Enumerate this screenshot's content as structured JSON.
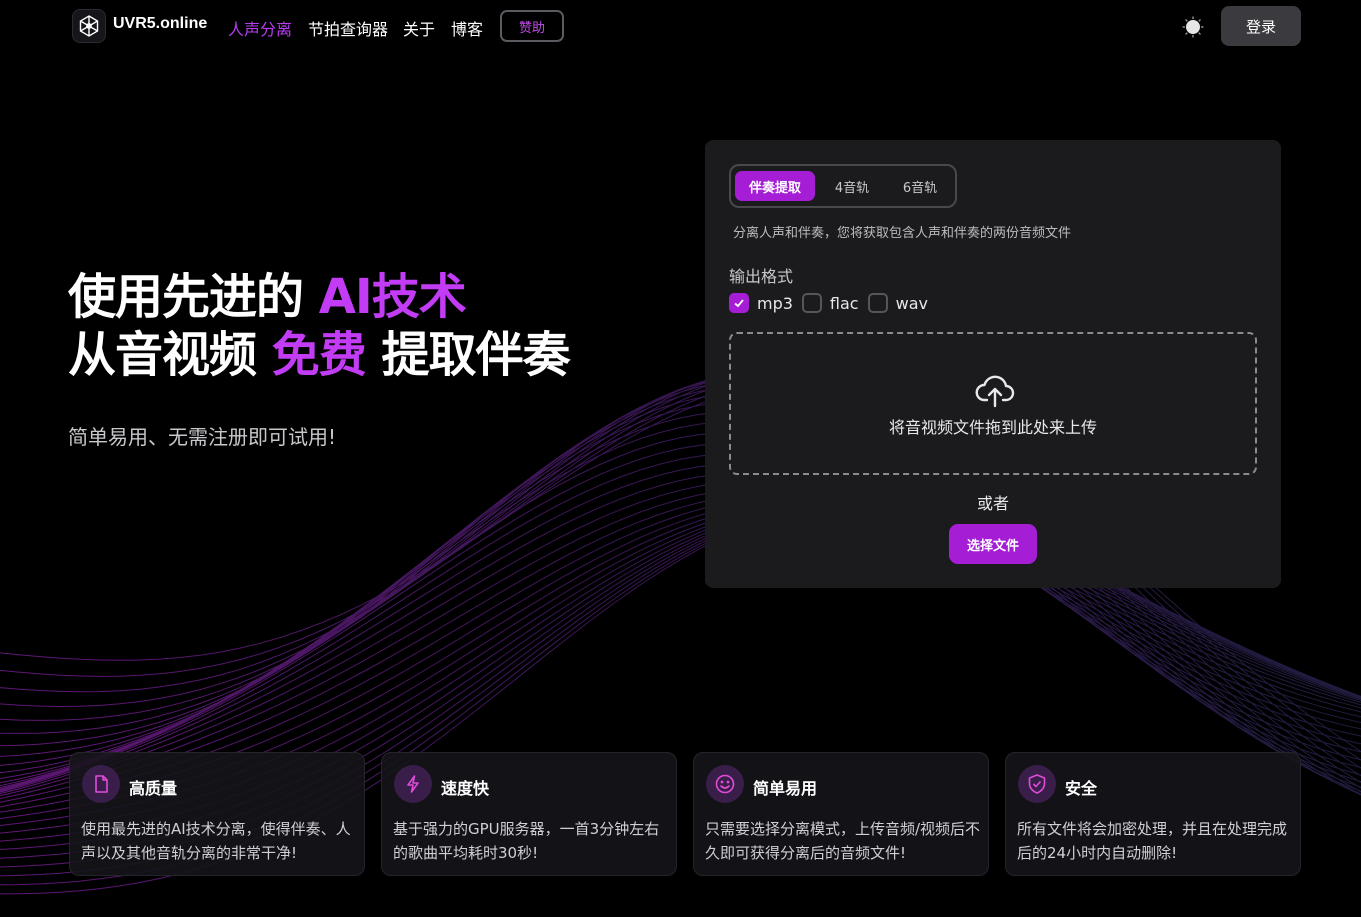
{
  "nav": {
    "brand": "UVR5.online",
    "links": [
      "人声分离",
      "节拍查询器",
      "关于",
      "博客"
    ],
    "active_link": "人声分离",
    "sponsor_label": "赞助",
    "login_label": "登录"
  },
  "hero": {
    "line1_pre": "使用先进的 ",
    "line1_hl": "AI技术",
    "line2_pre": "从音视频 ",
    "line2_hl": "免费",
    "line2_post": " 提取伴奏",
    "subtitle": "简单易用、无需注册即可试用!"
  },
  "panel": {
    "tabs": [
      "伴奏提取",
      "4音轨",
      "6音轨"
    ],
    "active_tab": "伴奏提取",
    "mode_description": "分离人声和伴奏，您将获取包含人声和伴奏的两份音频文件",
    "format_label": "输出格式",
    "formats": [
      {
        "label": "mp3",
        "checked": true
      },
      {
        "label": "flac",
        "checked": false
      },
      {
        "label": "wav",
        "checked": false
      }
    ],
    "dropzone_text": "将音视频文件拖到此处来上传",
    "or_text": "或者",
    "select_file_label": "选择文件"
  },
  "features": [
    {
      "icon": "file-icon",
      "title": "高质量",
      "desc": "使用最先进的AI技术分离，使得伴奏、人声以及其他音轨分离的非常干净!"
    },
    {
      "icon": "lightning-icon",
      "title": "速度快",
      "desc": "基于强力的GPU服务器，一首3分钟左右的歌曲平均耗时30秒!"
    },
    {
      "icon": "smile-icon",
      "title": "简单易用",
      "desc": "只需要选择分离模式，上传音频/视频后不久即可获得分离后的音频文件!"
    },
    {
      "icon": "shield-check-icon",
      "title": "安全",
      "desc": "所有文件将会加密处理，并且在处理完成后的24小时内自动删除!"
    }
  ],
  "colors": {
    "accent": "#a51ed6",
    "accent_text": "#c23cf5",
    "panel_bg": "#1b1b1e",
    "page_bg": "#000000"
  }
}
